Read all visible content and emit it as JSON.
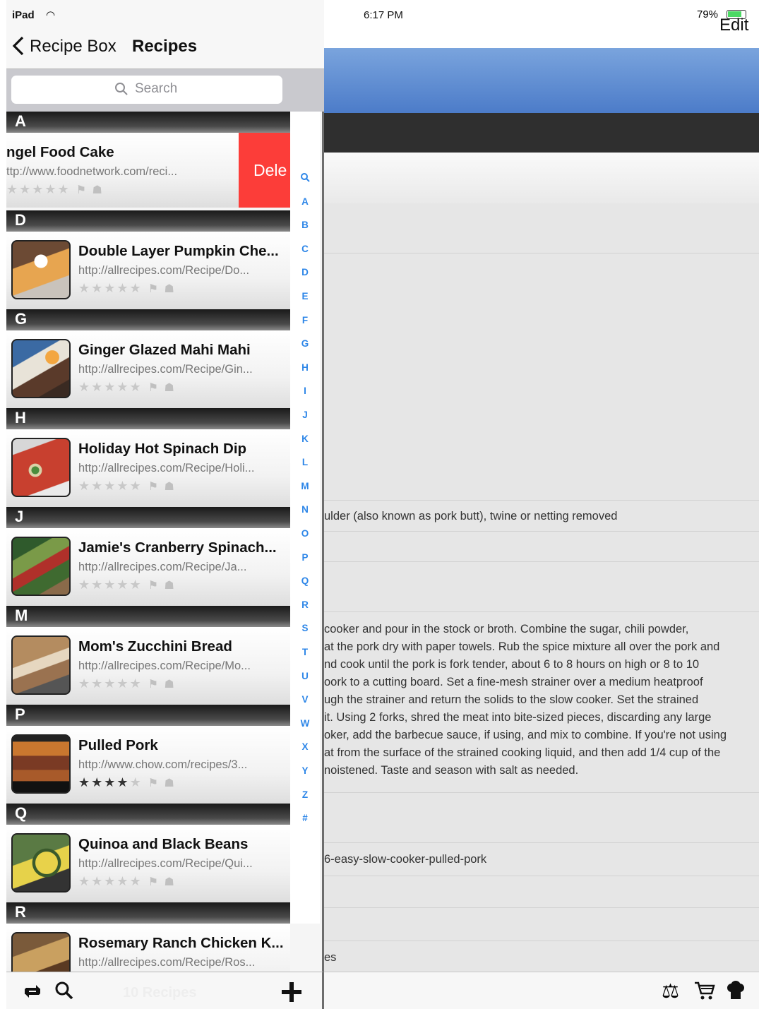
{
  "status": {
    "device": "iPad",
    "time": "6:17 PM",
    "battery": "79%"
  },
  "detail": {
    "edit_label": "Edit",
    "ingredient_line": "ulder (also known as pork butt), twine or netting removed",
    "directions": [
      "cooker and pour in the stock or broth. Combine the sugar, chili powder,",
      "at the pork dry with paper towels. Rub the spice mixture all over the pork and",
      "nd cook until the pork is fork tender, about 6 to 8 hours on high or 8 to 10",
      "oork to a cutting board. Set a fine-mesh strainer over a medium heatproof",
      "ugh the strainer and return the solids to the slow cooker. Set the strained",
      " it. Using 2 forks, shred the meat into bite-sized pieces, discarding any large",
      "oker, add the barbecue sauce, if using, and mix to combine. If you're not using",
      "at from the surface of the strained cooking liquid, and then add 1/4 cup of the",
      "noistened. Taste and season with salt as needed."
    ],
    "source_line": "6-easy-slow-cooker-pulled-pork",
    "bottom_line": "es"
  },
  "nav": {
    "back_label": "Recipe Box",
    "title": "Recipes"
  },
  "search": {
    "placeholder": "Search"
  },
  "swipe_row": {
    "title": "ngel Food Cake",
    "url": "ttp://www.foodnetwork.com/reci...",
    "delete_label": "Dele",
    "rating": 0
  },
  "sections": [
    {
      "letter": "A"
    },
    {
      "letter": "D",
      "title": "Double Layer Pumpkin Che...",
      "url": "http://allrecipes.com/Recipe/Do...",
      "rating": 0
    },
    {
      "letter": "G",
      "title": "Ginger Glazed Mahi Mahi",
      "url": "http://allrecipes.com/Recipe/Gin...",
      "rating": 0
    },
    {
      "letter": "H",
      "title": "Holiday Hot Spinach Dip",
      "url": "http://allrecipes.com/Recipe/Holi...",
      "rating": 0
    },
    {
      "letter": "J",
      "title": "Jamie's Cranberry Spinach...",
      "url": "http://allrecipes.com/Recipe/Ja...",
      "rating": 0
    },
    {
      "letter": "M",
      "title": "Mom's Zucchini Bread",
      "url": "http://allrecipes.com/Recipe/Mo...",
      "rating": 0
    },
    {
      "letter": "P",
      "title": "Pulled Pork",
      "url": "http://www.chow.com/recipes/3...",
      "rating": 4
    },
    {
      "letter": "Q",
      "title": "Quinoa and Black Beans",
      "url": "http://allrecipes.com/Recipe/Qui...",
      "rating": 0
    },
    {
      "letter": "R",
      "title": "Rosemary Ranch Chicken K...",
      "url": "http://allrecipes.com/Recipe/Ros...",
      "rating": 0
    }
  ],
  "index": [
    "search-icon",
    "A",
    "B",
    "C",
    "D",
    "E",
    "F",
    "G",
    "H",
    "I",
    "J",
    "K",
    "L",
    "M",
    "N",
    "O",
    "P",
    "Q",
    "R",
    "S",
    "T",
    "U",
    "V",
    "W",
    "X",
    "Y",
    "Z",
    "#"
  ],
  "toolbar": {
    "count_label": "10 Recipes",
    "icons": [
      "sync-icon",
      "search-icon",
      "add-icon"
    ]
  },
  "detail_toolbar": {
    "icons": [
      "scale-icon",
      "shopping-cart-icon",
      "chef-hat-icon"
    ]
  },
  "colors": {
    "accent": "#2d86e8",
    "delete": "#fc3d39",
    "header_blue": "#5b87d0"
  }
}
